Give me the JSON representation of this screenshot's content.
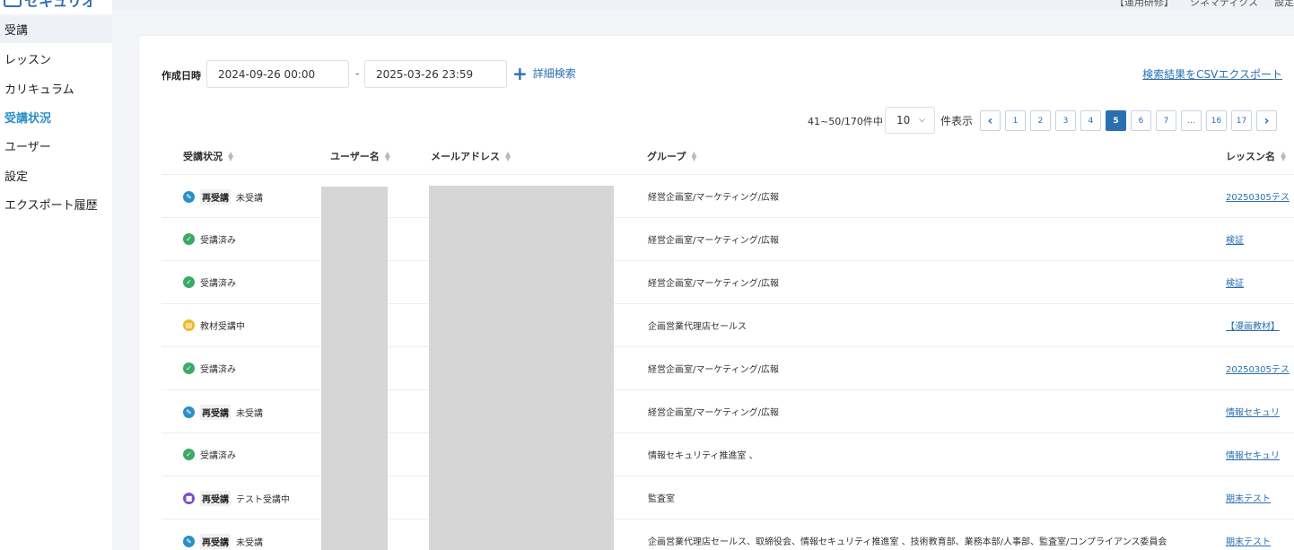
{
  "app": {
    "logo_text": "セキュリオ"
  },
  "topbar": {
    "text_a": "【運用研修】",
    "text_b": "シネマティクス",
    "text_c": "設定"
  },
  "sidebar": {
    "items": [
      {
        "label": "受講"
      },
      {
        "label": "レッスン"
      },
      {
        "label": "カリキュラム"
      },
      {
        "label": "受講状況"
      },
      {
        "label": "ユーザー"
      },
      {
        "label": "設定"
      },
      {
        "label": "エクスポート履歴"
      }
    ]
  },
  "filters": {
    "created_label": "作成日時",
    "date_from": "2024-09-26 00:00",
    "date_separator": "-",
    "date_to": "2025-03-26 23:59",
    "detail_search_label": "詳細検索",
    "csv_export_label": "検索結果をCSVエクスポート"
  },
  "pagination": {
    "count_text": "41~50/170件中",
    "per_page": "10",
    "per_page_suffix": "件表示",
    "pages": [
      "1",
      "2",
      "3",
      "4",
      "5",
      "6",
      "7",
      "...",
      "16",
      "17"
    ],
    "current_page": "5"
  },
  "table": {
    "headers": {
      "status": "受講状況",
      "user": "ユーザー名",
      "email": "メールアドレス",
      "group": "グループ",
      "lesson": "レッスン名"
    },
    "re_badge": "再受講",
    "rows": [
      {
        "status_icon": "pencil-icon",
        "status_color": "#2a8fc7",
        "re": true,
        "status": "未受講",
        "group": "経営企画室/マーケティング/広報",
        "lesson": "20250305テス"
      },
      {
        "status_icon": "check-icon",
        "status_color": "#3aaa66",
        "re": false,
        "status": "受講済み",
        "group": "経営企画室/マーケティング/広報",
        "lesson": "検証"
      },
      {
        "status_icon": "check-icon",
        "status_color": "#3aaa66",
        "re": false,
        "status": "受講済み",
        "group": "経営企画室/マーケティング/広報",
        "lesson": "検証"
      },
      {
        "status_icon": "book-icon",
        "status_color": "#f0b82e",
        "re": false,
        "status": "教材受講中",
        "group": "企画営業代理店セールス",
        "lesson": "【漫画教材】"
      },
      {
        "status_icon": "check-icon",
        "status_color": "#3aaa66",
        "re": false,
        "status": "受講済み",
        "group": "経営企画室/マーケティング/広報",
        "lesson": "20250305テス"
      },
      {
        "status_icon": "pencil-icon",
        "status_color": "#2a8fc7",
        "re": true,
        "status": "未受講",
        "group": "経営企画室/マーケティング/広報",
        "lesson": "情報セキュリ"
      },
      {
        "status_icon": "check-icon",
        "status_color": "#3aaa66",
        "re": false,
        "status": "受講済み",
        "group": "情報セキュリティ推進室 、",
        "lesson": "情報セキュリ"
      },
      {
        "status_icon": "test-icon",
        "status_color": "#7b4fc9",
        "re": true,
        "status": "テスト受講中",
        "group": "監査室",
        "lesson": "期末テスト"
      },
      {
        "status_icon": "pencil-icon",
        "status_color": "#2a8fc7",
        "re": true,
        "status": "未受講",
        "group": "企画営業代理店セールス、取締役会、情報セキュリティ推進室 、技術教育部、業務本部/人事部、監査室/コンプライアンス委員会",
        "lesson": "期末テスト"
      }
    ]
  }
}
